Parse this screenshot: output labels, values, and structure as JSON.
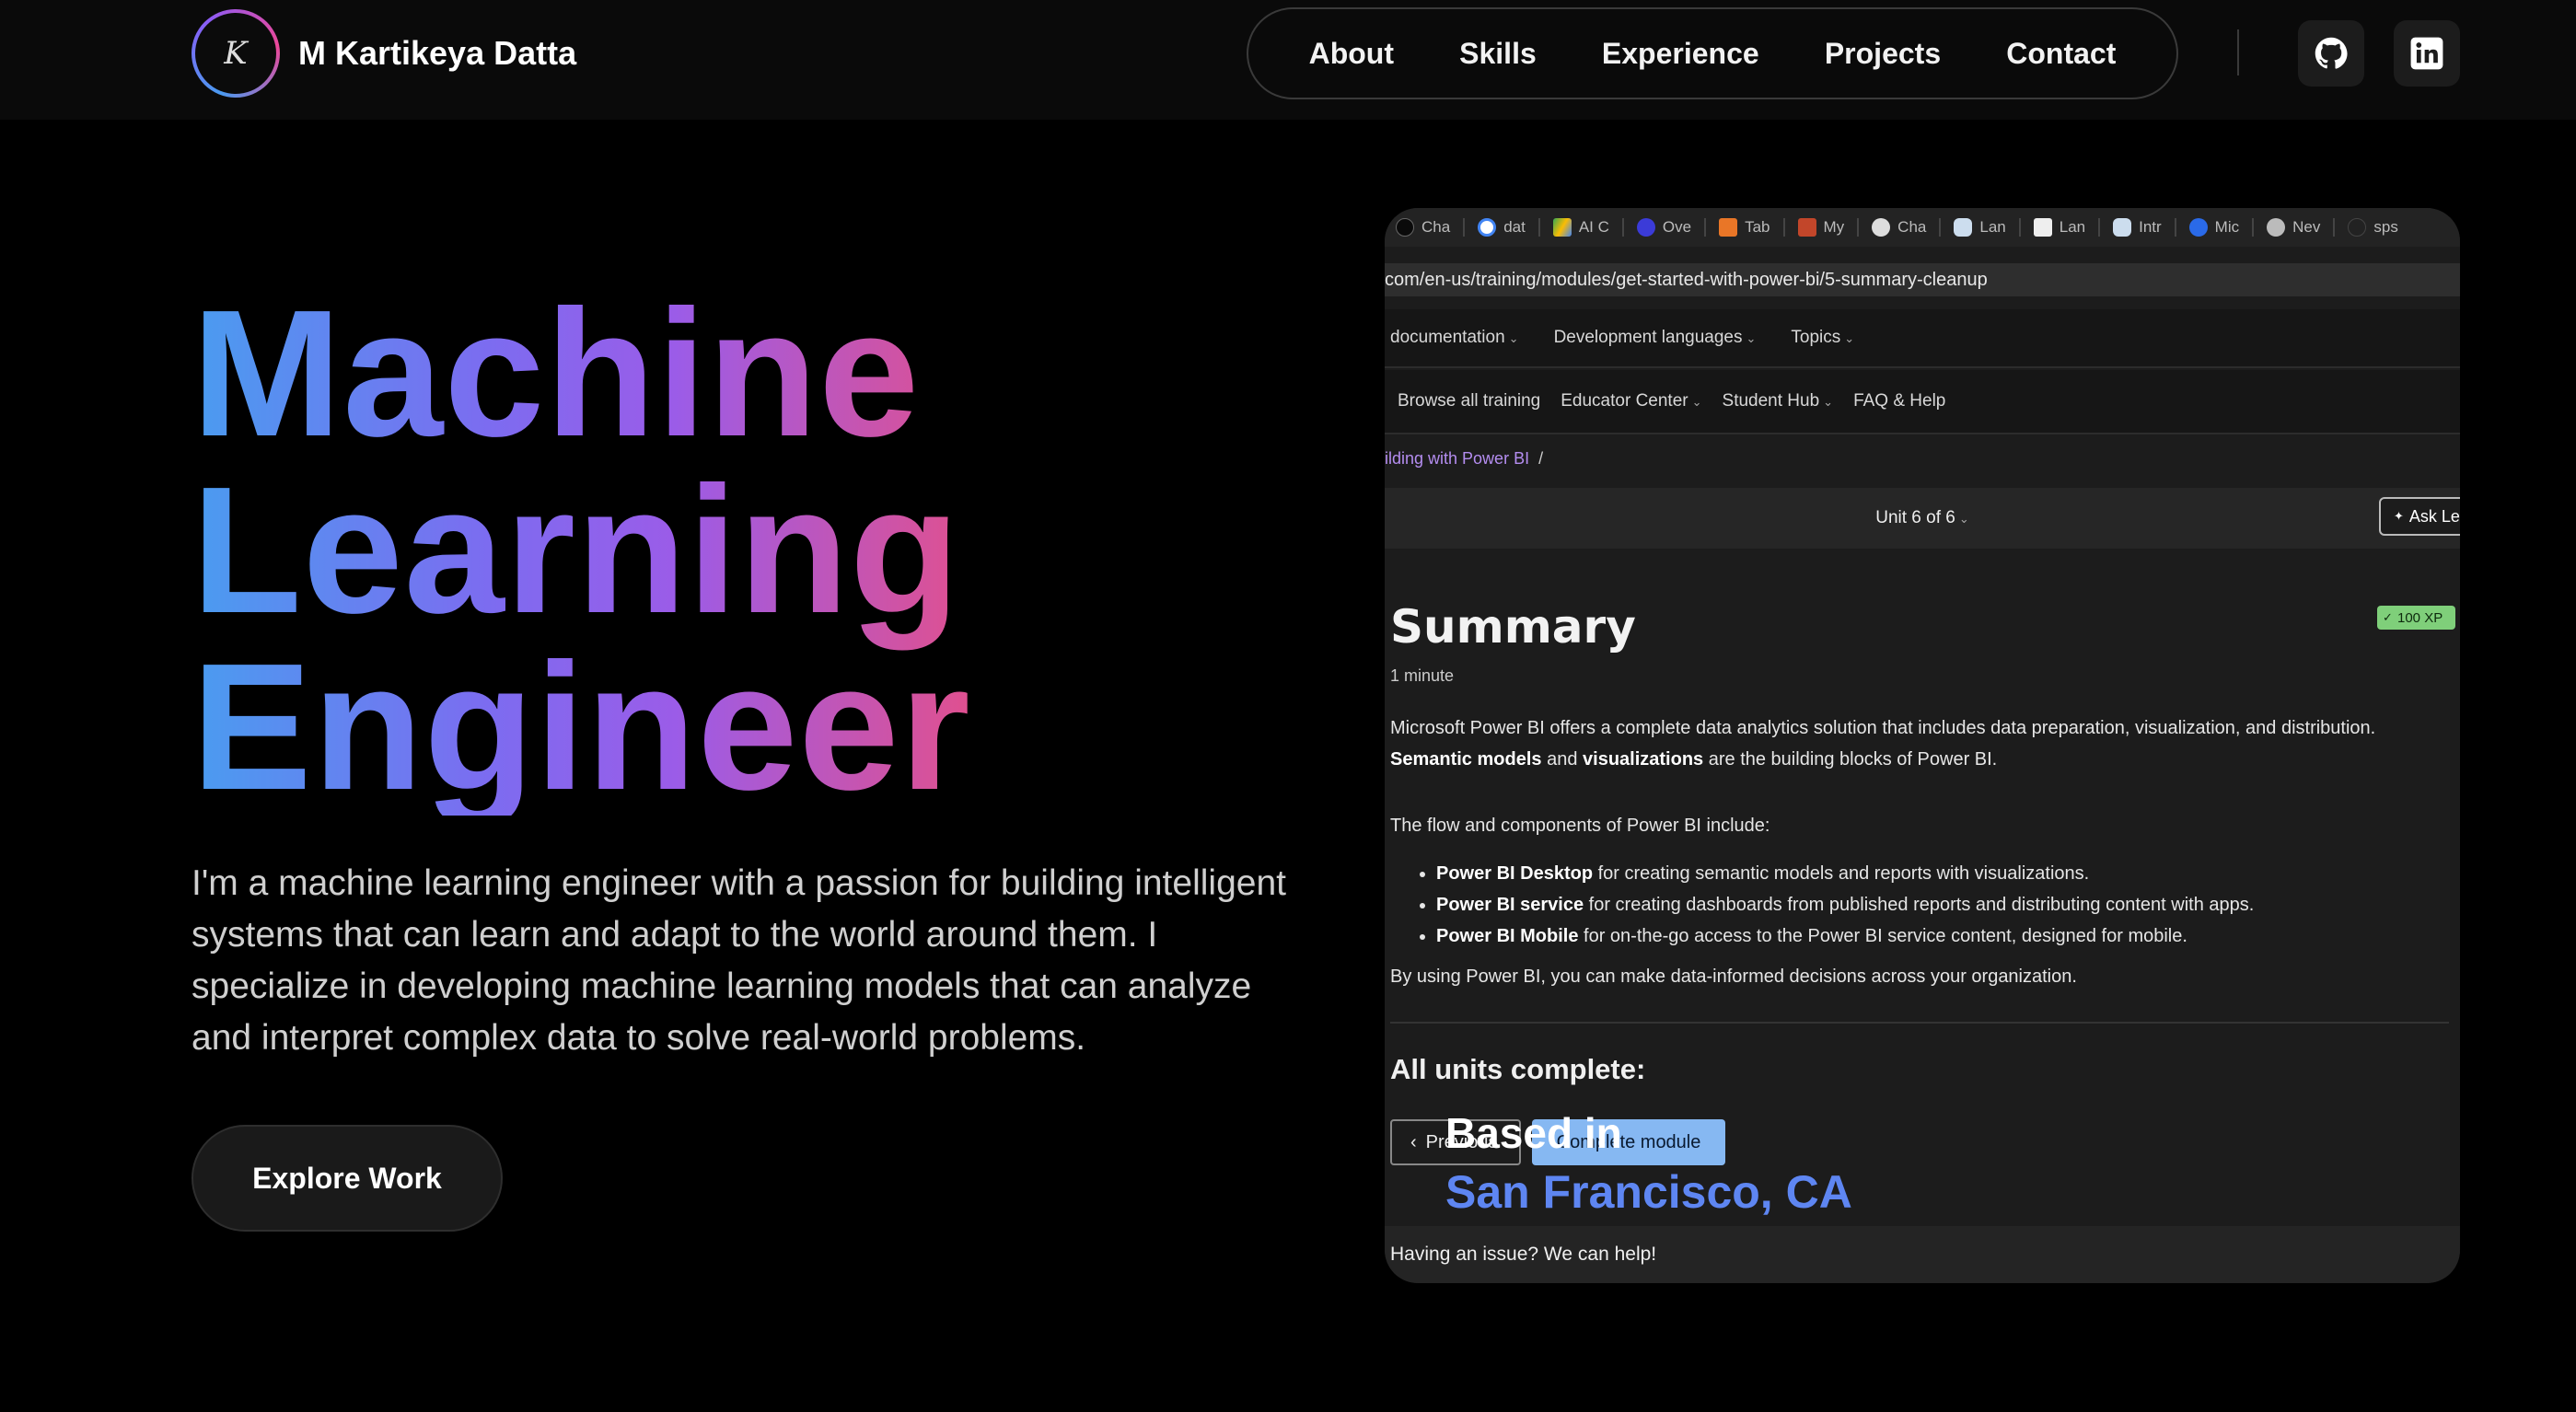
{
  "nav": {
    "logo_initials": "K",
    "brand_name": "M Kartikeya Datta",
    "links": [
      {
        "label": "About"
      },
      {
        "label": "Skills"
      },
      {
        "label": "Experience"
      },
      {
        "label": "Projects"
      },
      {
        "label": "Contact"
      }
    ],
    "social": [
      {
        "icon": "github-icon"
      },
      {
        "icon": "linkedin-icon"
      }
    ]
  },
  "hero": {
    "title_lines": [
      "Machine",
      "Learning",
      "Engineer"
    ],
    "description": "I'm a machine learning engineer with a passion for building intelligent systems that can learn and adapt to the world around them. I specialize in developing machine learning models that can analyze and interpret complex data to solve real-world problems.",
    "cta_label": "Explore Work",
    "gradient_colors": [
      "#4a9cf0",
      "#7c6cf0",
      "#9b5ce8",
      "#e0508f"
    ],
    "location_label": "Based in",
    "location_value": "San Francisco, CA",
    "location_color": "#5e86f2"
  },
  "screenshot": {
    "tabs": [
      {
        "label": "Cha"
      },
      {
        "label": "dat"
      },
      {
        "label": "AI C"
      },
      {
        "label": "Ove"
      },
      {
        "label": "Tab"
      },
      {
        "label": "My"
      },
      {
        "label": "Cha"
      },
      {
        "label": "Lan"
      },
      {
        "label": "Lan"
      },
      {
        "label": "Intr"
      },
      {
        "label": "Mic"
      },
      {
        "label": "Nev"
      },
      {
        "label": "sps"
      }
    ],
    "url": "com/en-us/training/modules/get-started-with-power-bi/5-summary-cleanup",
    "menu_row1": [
      "documentation",
      "Development languages",
      "Topics"
    ],
    "menu_row2": [
      "Browse all training",
      "Educator Center",
      "Student Hub",
      "FAQ & Help"
    ],
    "breadcrumb": "ilding with Power BI",
    "breadcrumb_sep": "/",
    "unit_label": "Unit 6 of 6",
    "ask_button": "Ask Le",
    "heading": "Summary",
    "xp_badge": "100 XP",
    "duration": "1 minute",
    "p1_text": "Microsoft Power BI offers a complete data analytics solution that includes data preparation, visualization, and distribution.",
    "p1_bold1": "Semantic models",
    "p1_and": "and",
    "p1_bold2": "visualizations",
    "p1_tail": "are the building blocks of Power BI.",
    "p2": "The flow and components of Power BI include:",
    "bullets": [
      {
        "bold": "Power BI Desktop",
        "text": "for creating semantic models and reports with visualizations."
      },
      {
        "bold": "Power BI service",
        "text": "for creating dashboards from published reports and distributing content with apps."
      },
      {
        "bold": "Power BI Mobile",
        "text": "for on-the-go access to the Power BI service content, designed for mobile."
      }
    ],
    "p3": "By using Power BI, you can make data-informed decisions across your organization.",
    "units_heading": "All units complete:",
    "prev_button": "Previous",
    "complete_button": "Complete module",
    "footer": "Having an issue? We can help!"
  }
}
